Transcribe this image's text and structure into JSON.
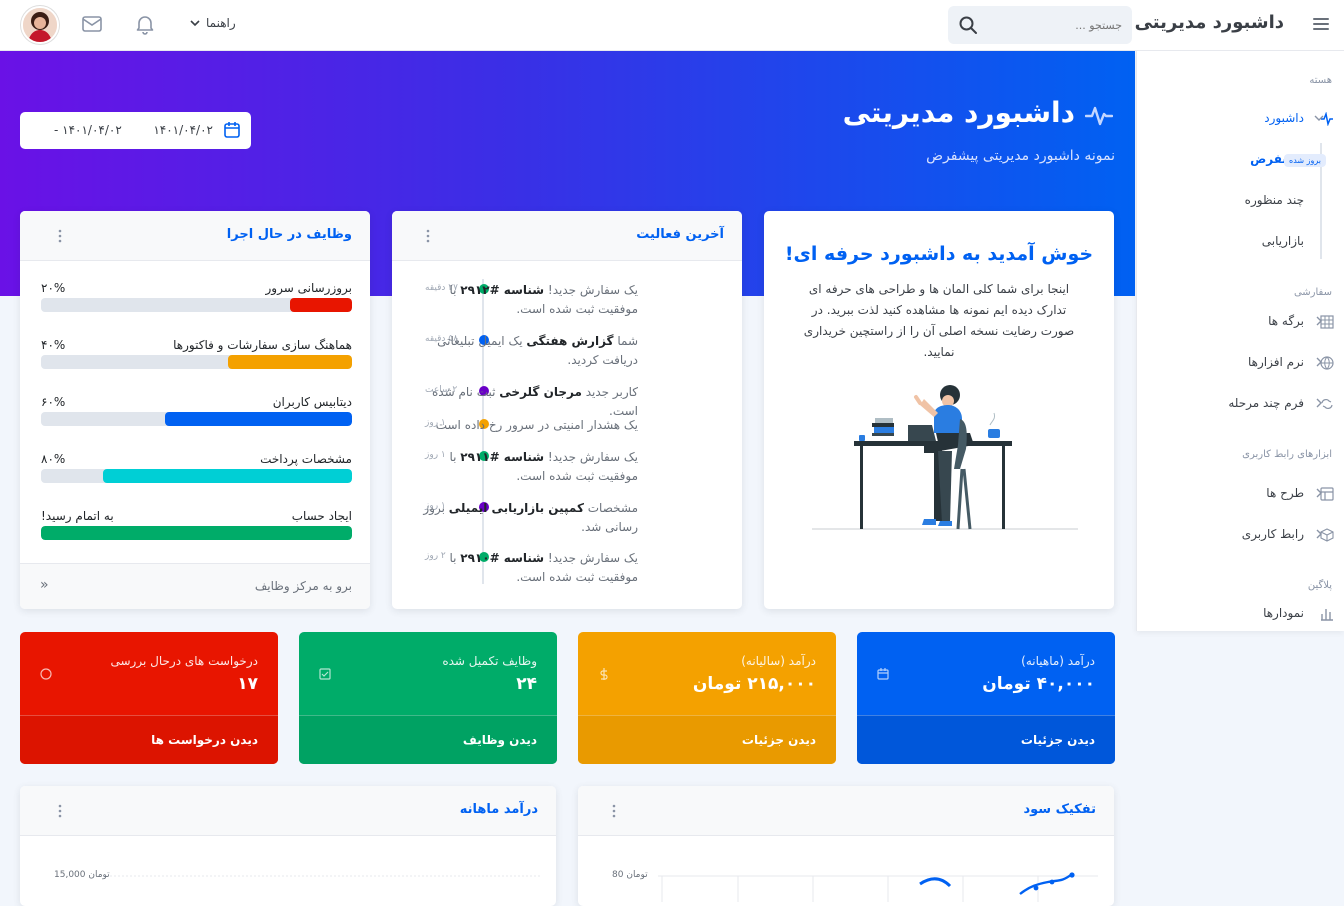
{
  "topbar": {
    "brand": "داشبورد مدیریتی",
    "search_placeholder": "جستجو ...",
    "help_menu": "راهنما"
  },
  "sidebar": {
    "section_core": "هسته",
    "dashboard": "داشبورد",
    "sub_default": "پیشفرض",
    "badge_updated": "بروز شده",
    "sub_multi": "چند منظوره",
    "sub_marketing": "بازاریابی",
    "section_custom": "سفارشی",
    "pages": "برگه ها",
    "software": "نرم افزارها",
    "multistep_form": "فرم چند مرحله",
    "section_ui": "ابزارهای رابط کاربری",
    "layouts": "طرح ها",
    "ui": "رابط کاربری",
    "section_plugins": "پلاگین",
    "charts": "نمودارها"
  },
  "hero": {
    "title": "داشبورد مدیریتی",
    "subtitle": "نمونه داشبورد مدیریتی پیشفرض",
    "date_from": "۱۴۰۱/۰۴/۰۲",
    "date_to": "- ۱۴۰۱/۰۴/۰۲"
  },
  "welcome": {
    "title": "خوش آمدید به داشبورد حرفه ای!",
    "text": "اینجا برای شما کلی المان ها و طراحی های حرفه ای تدارک دیده ایم نمونه ها مشاهده کنید لذت ببرید. در صورت رضایت نسخه اصلی آن را از راستچین خریداری نمایید."
  },
  "activity": {
    "title": "آخرین فعالیت",
    "items": [
      {
        "time": "۲۷ دقیقه",
        "color": "#00ac69",
        "pre": "یک سفارش جدید! ",
        "bold": "شناسه #۲۹۱۲",
        "post": " با موفقیت ثبت شده است."
      },
      {
        "time": "۵۸ دقیقه",
        "color": "#0061f2",
        "pre": "شما ",
        "bold": "گزارش هفتگی",
        "post": " یک ایمیل تبلیغاتی دریافت کردید."
      },
      {
        "time": "۲ ساعت",
        "color": "#6900c7",
        "pre": "کاربر جدید ",
        "bold": "مرجان گلرخی",
        "post": " ثبت نام شده است."
      },
      {
        "time": "۱ روز",
        "color": "#f4a100",
        "pre": "یک هشدار امنیتی در سرور رخ داده است",
        "bold": "",
        "post": ""
      },
      {
        "time": "۱ روز",
        "color": "#00ac69",
        "pre": "یک سفارش جدید! ",
        "bold": "شناسه #۲۹۱۱",
        "post": " با موفقیت ثبت شده است."
      },
      {
        "time": "۱ روز",
        "color": "#6900c7",
        "pre": "مشخصات ",
        "bold": "کمپین بازاریابی ایمیلی",
        "post": " بروز رسانی شد."
      },
      {
        "time": "۲ روز",
        "color": "#00ac69",
        "pre": "یک سفارش جدید! ",
        "bold": "شناسه #۲۹۱۰",
        "post": " با موفقیت ثبت شده است."
      }
    ]
  },
  "tasks": {
    "title": "وظایف در حال اجرا",
    "items": [
      {
        "label": "بروزرسانی سرور",
        "value": "۲۰%",
        "fraction": 0.2,
        "color": "#e81500"
      },
      {
        "label": "هماهنگ سازی سفارشات و فاکتورها",
        "value": "۴۰%",
        "fraction": 0.4,
        "color": "#f4a100"
      },
      {
        "label": "دیتابیس کاربران",
        "value": "۶۰%",
        "fraction": 0.6,
        "color": "#0061f2"
      },
      {
        "label": "مشخصات پرداخت",
        "value": "۸۰%",
        "fraction": 0.8,
        "color": "#00cfd5"
      },
      {
        "label": "ایجاد حساب",
        "value": "به اتمام رسید!",
        "fraction": 1.0,
        "color": "#00ac69"
      }
    ],
    "footer": "برو به مرکز وظایف",
    "footer_arrow": "»"
  },
  "stats": [
    {
      "label": "درآمد (ماهیانه)",
      "value": "۴۰,۰۰۰ تومان",
      "link": "دیدن جزئیات",
      "color": "#0061f2",
      "foot_color": "#0057da",
      "icon": "calendar-icon"
    },
    {
      "label": "درآمد (سالیانه)",
      "value": "۲۱۵,۰۰۰ تومان",
      "link": "دیدن جزئیات",
      "color": "#f4a100",
      "foot_color": "#e99a00",
      "icon": "dollar-icon"
    },
    {
      "label": "وظایف تکمیل شده",
      "value": "۲۴",
      "link": "دیدن وظایف",
      "color": "#00ac69",
      "foot_color": "#00a263",
      "icon": "check-square-icon"
    },
    {
      "label": "درخواست های درحال بررسی",
      "value": "۱۷",
      "link": "دیدن درخواست ها",
      "color": "#e81500",
      "foot_color": "#dc1400",
      "icon": "circle-icon"
    }
  ],
  "profit_chart": {
    "title": "تفکیک سود",
    "axis_top": "80 تومان"
  },
  "revenue_chart": {
    "title": "درآمد ماهانه",
    "axis_top": "15,000 تومان"
  }
}
